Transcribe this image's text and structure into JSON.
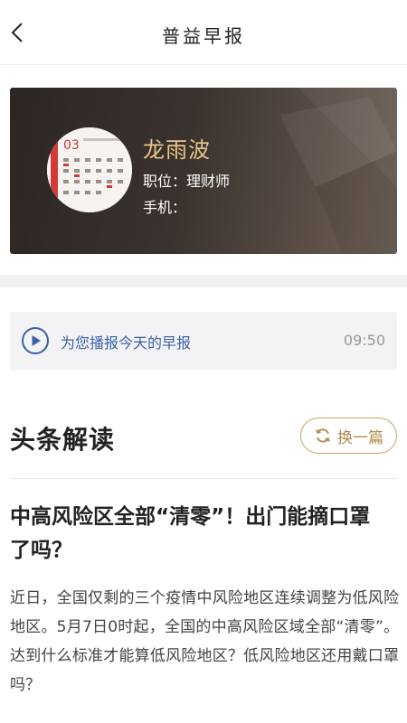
{
  "nav": {
    "title": "普益早报",
    "back_icon": "chevron-left-icon"
  },
  "profile": {
    "name": "龙雨波",
    "role_label": "职位：理财师",
    "phone_label": "手机：",
    "avatar_calendar_month": "03",
    "colors": {
      "name": "#e9c58a",
      "card_bg": "#3a322e"
    }
  },
  "player": {
    "label": "为您播报今天的早报",
    "duration": "09:50",
    "icon": "play-icon",
    "color": "#3b5fa8"
  },
  "section": {
    "title": "头条解读",
    "swap_label": "换一篇",
    "swap_icon": "refresh-icon",
    "accent": "#c9a25e"
  },
  "article": {
    "headline": "中高风险区全部“清零”！出门能摘口罩了吗？",
    "summary": "近日，全国仅剩的三个疫情中风险地区连续调整为低风险地区。5月7日0时起，全国的中高风险区域全部“清零”。达到什么标准才能算低风险地区？低风险地区还用戴口罩吗？"
  }
}
